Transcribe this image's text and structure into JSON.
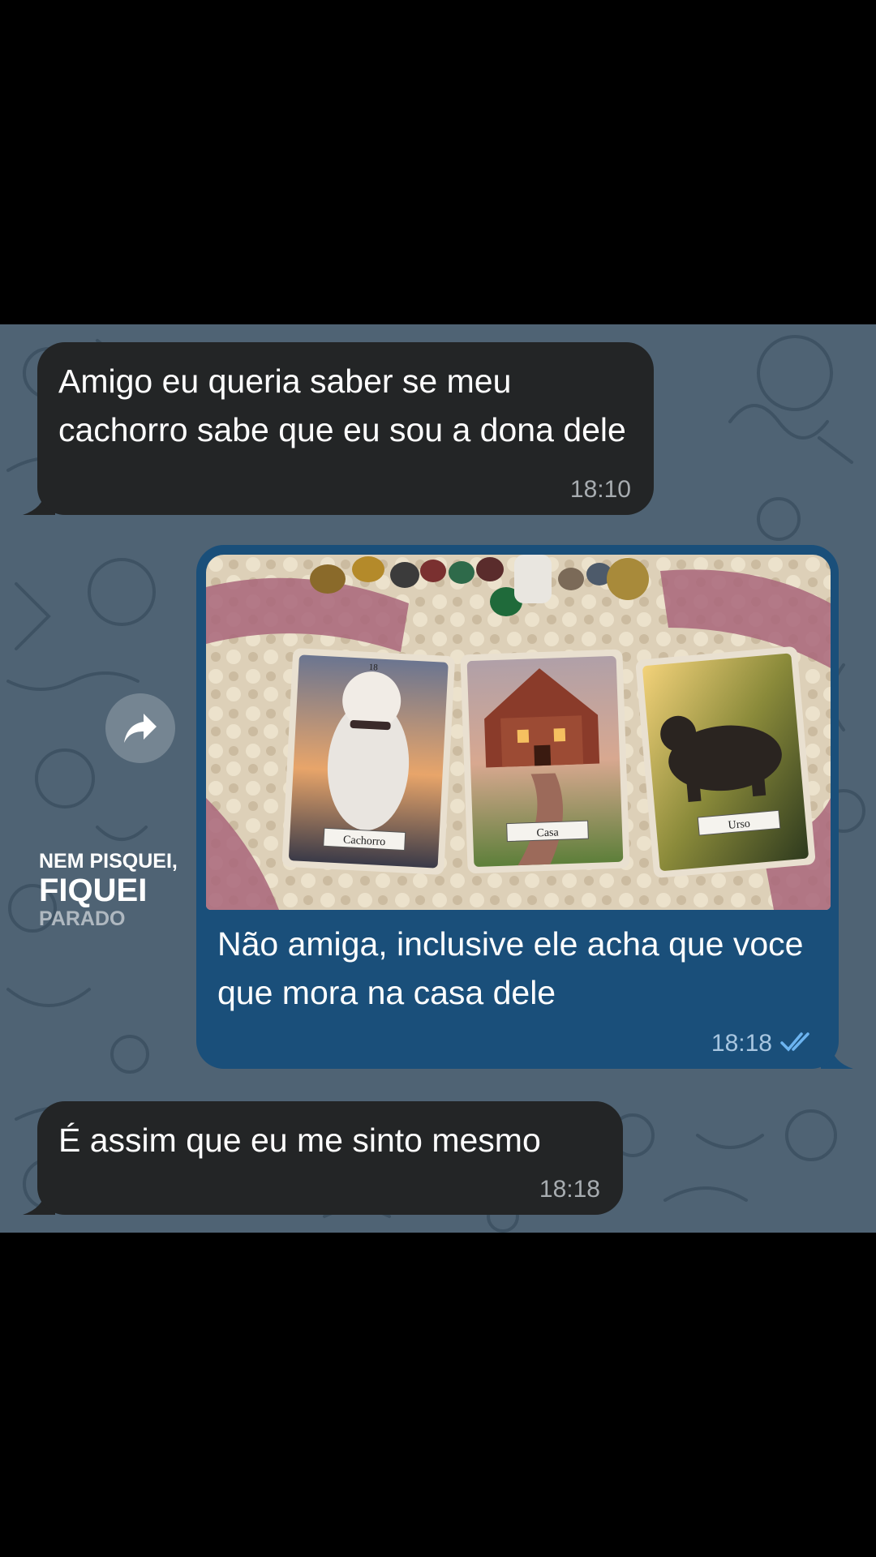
{
  "messages": [
    {
      "direction": "incoming",
      "text": "Amigo eu queria saber se meu cachorro sabe que eu sou a dona dele",
      "time": "18:10"
    },
    {
      "direction": "outgoing",
      "text": "Não amiga, inclusive ele acha que voce que mora na casa dele",
      "time": "18:18",
      "status_icon": "double-check-icon",
      "photo": {
        "description_icon": "tarot-cards-photo",
        "card_labels": [
          "Cachorro",
          "Casa",
          "Urso"
        ],
        "card_numbers": [
          "18",
          "",
          ""
        ]
      }
    },
    {
      "direction": "incoming",
      "text": "É assim que eu me sinto mesmo",
      "time": "18:18"
    }
  ],
  "watermark": {
    "line1": "NEM PISQUEI,",
    "line2": "FIQUEI",
    "line3": "PARADO"
  },
  "colors": {
    "incoming_bubble": "#232526",
    "outgoing_bubble": "#1a4f7a",
    "chat_background": "#4f6374",
    "read_check": "#6cb4f0"
  }
}
